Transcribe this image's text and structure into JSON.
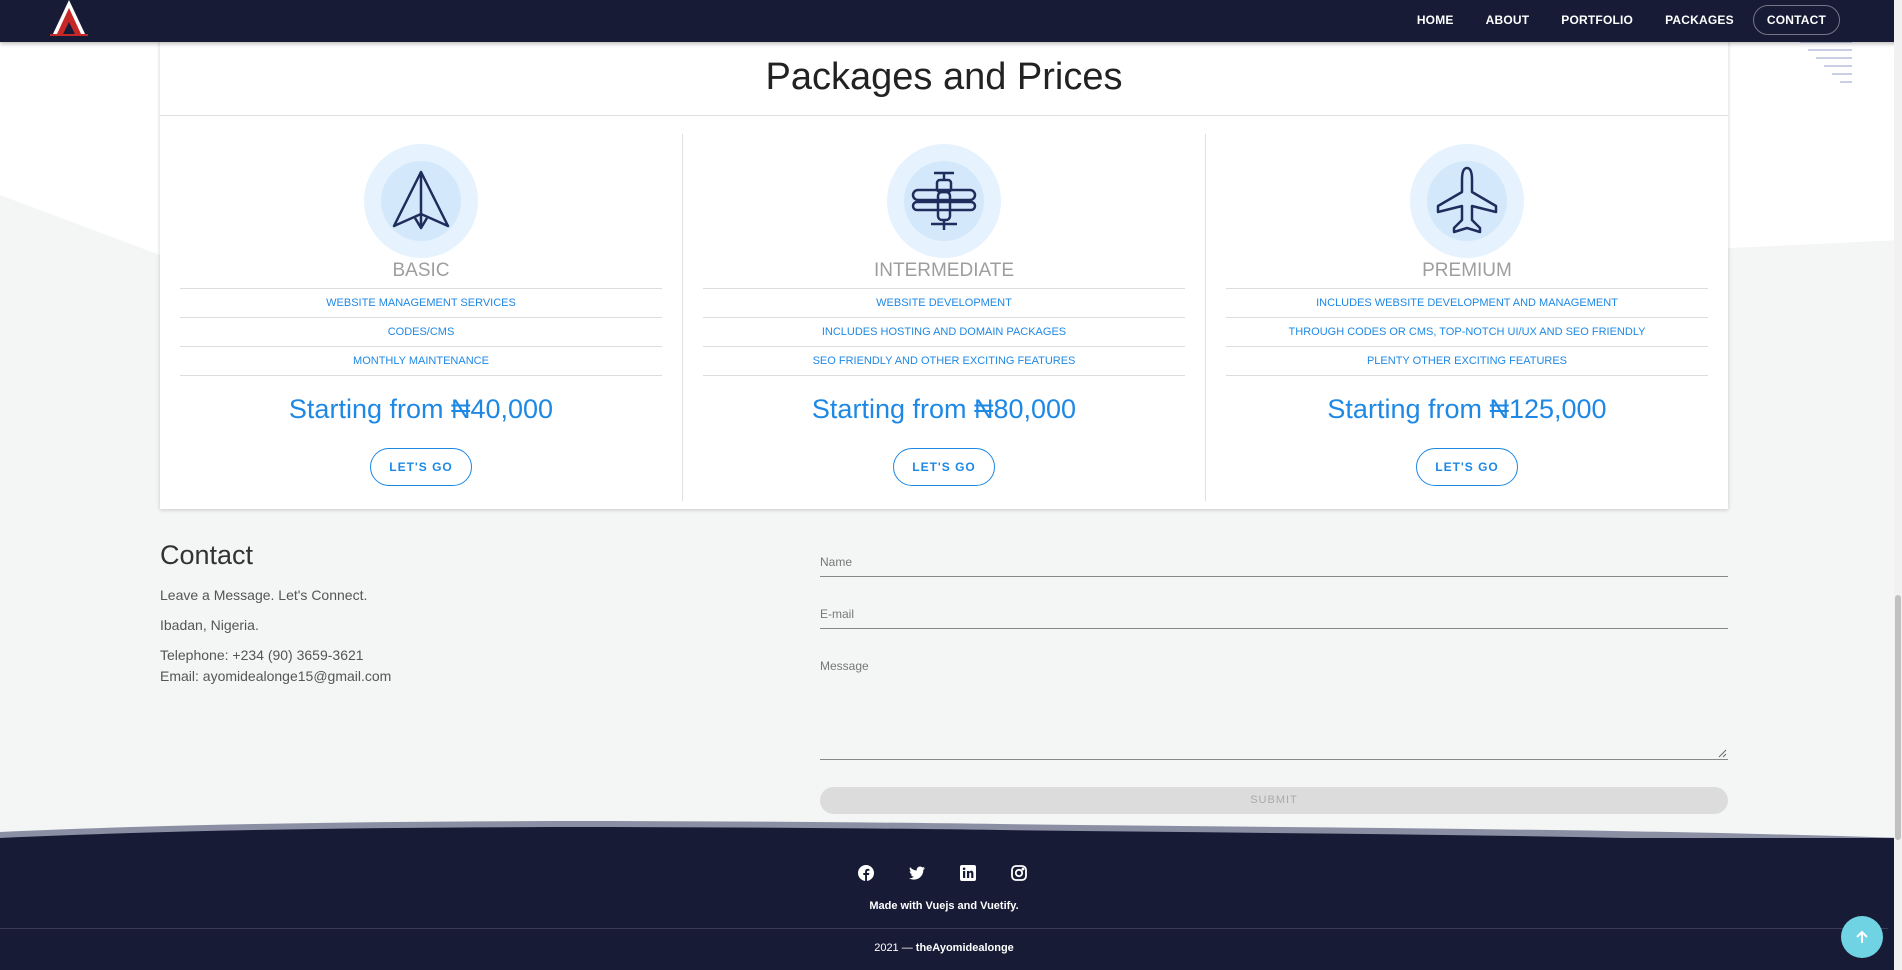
{
  "nav": {
    "items": [
      {
        "label": "HOME"
      },
      {
        "label": "ABOUT"
      },
      {
        "label": "PORTFOLIO"
      },
      {
        "label": "PACKAGES"
      },
      {
        "label": "CONTACT"
      }
    ]
  },
  "packages": {
    "title": "Packages and Prices",
    "items": [
      {
        "name": "BASIC",
        "icon": "paper-plane-icon",
        "features": [
          "WEBSITE MANAGEMENT SERVICES",
          "CODES/CMS",
          "MONTHLY MAINTENANCE"
        ],
        "price": "Starting from ₦40,000",
        "button": "LET'S GO"
      },
      {
        "name": "INTERMEDIATE",
        "icon": "biplane-icon",
        "features": [
          "WEBSITE DEVELOPMENT",
          "INCLUDES HOSTING AND DOMAIN PACKAGES",
          "SEO FRIENDLY AND OTHER EXCITING FEATURES"
        ],
        "price": "Starting from ₦80,000",
        "button": "LET'S GO"
      },
      {
        "name": "PREMIUM",
        "icon": "airplane-icon",
        "features": [
          "INCLUDES WEBSITE DEVELOPMENT AND MANAGEMENT",
          "THROUGH CODES OR CMS, TOP-NOTCH UI/UX AND SEO FRIENDLY",
          "PLENTY OTHER EXCITING FEATURES"
        ],
        "price": "Starting from ₦125,000",
        "button": "LET'S GO"
      }
    ]
  },
  "contact": {
    "title": "Contact",
    "tagline": "Leave a Message. Let's Connect.",
    "location": "Ibadan, Nigeria.",
    "telephone": "Telephone: +234 (90) 3659-3621",
    "email": "Email: ayomidealonge15@gmail.com",
    "form": {
      "name_placeholder": "Name",
      "email_placeholder": "E-mail",
      "message_placeholder": "Message",
      "submit_label": "SUBMIT"
    }
  },
  "footer": {
    "socials": [
      "facebook-icon",
      "twitter-icon",
      "linkedin-icon",
      "instagram-icon"
    ],
    "made_with": "Made with Vuejs and Vuetify.",
    "year": "2021 —",
    "owner": "theAyomidealonge"
  },
  "colors": {
    "nav_bg": "#171b36",
    "accent": "#1e88e5",
    "page_bg": "#f4f5f5",
    "scroll_top_bg": "#6fd3e3"
  }
}
